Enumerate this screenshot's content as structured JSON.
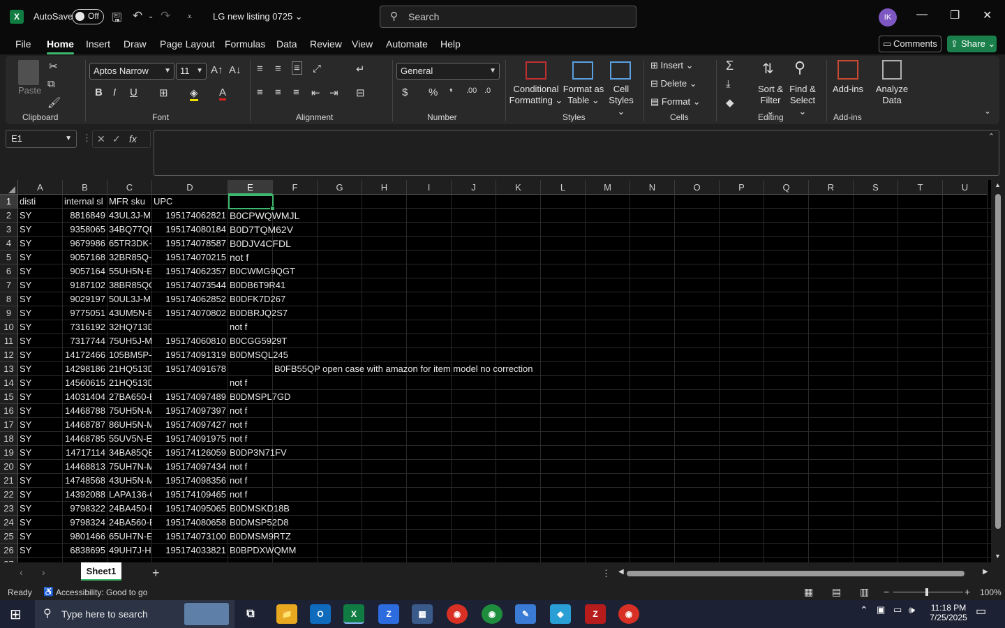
{
  "titlebar": {
    "autosave_label": "AutoSave",
    "autosave_state": "Off",
    "filename": "LG new listing 0725",
    "search_placeholder": "Search",
    "avatar_initials": "IK"
  },
  "menu": [
    "File",
    "Home",
    "Insert",
    "Draw",
    "Page Layout",
    "Formulas",
    "Data",
    "Review",
    "View",
    "Automate",
    "Help"
  ],
  "menu_active": "Home",
  "actions": {
    "comments": "Comments",
    "share": "Share"
  },
  "ribbon": {
    "clipboard": {
      "label": "Clipboard",
      "paste": "Paste"
    },
    "font": {
      "label": "Font",
      "family": "Aptos Narrow",
      "size": "11"
    },
    "alignment": {
      "label": "Alignment"
    },
    "number": {
      "label": "Number",
      "format": "General"
    },
    "styles": {
      "label": "Styles",
      "conditional_1": "Conditional",
      "conditional_2": "Formatting",
      "format_table_1": "Format as",
      "format_table_2": "Table",
      "cell_styles_1": "Cell",
      "cell_styles_2": "Styles"
    },
    "cells": {
      "label": "Cells",
      "insert": "Insert",
      "delete": "Delete",
      "format": "Format"
    },
    "editing": {
      "label": "Editing",
      "sort_1": "Sort &",
      "sort_2": "Filter",
      "find_1": "Find &",
      "find_2": "Select"
    },
    "addins": {
      "label": "Add-ins",
      "addins": "Add-ins",
      "analyze_1": "Analyze",
      "analyze_2": "Data"
    }
  },
  "formula_bar": {
    "name_box": "E1",
    "formula": ""
  },
  "columns": [
    "A",
    "B",
    "C",
    "D",
    "E",
    "F",
    "G",
    "H",
    "I",
    "J",
    "K",
    "L",
    "M",
    "N",
    "O",
    "P",
    "Q",
    "R",
    "S",
    "T",
    "U"
  ],
  "selected_column": "E",
  "selected_row": "1",
  "header_row": {
    "A": "disti",
    "B": "internal sl",
    "C": "MFR sku",
    "D": "UPC",
    "E": ""
  },
  "rows": [
    {
      "n": "2",
      "A": "SY",
      "B": "8816849",
      "C": "43UL3J-M",
      "D": "195174062821",
      "E": "B0CPWQWMJL",
      "big": true
    },
    {
      "n": "3",
      "A": "SY",
      "B": "9358065",
      "C": "34BQ77QE",
      "D": "195174080184",
      "E": "B0D7TQM62V",
      "big": true
    },
    {
      "n": "4",
      "A": "SY",
      "B": "9679986",
      "C": "65TR3DK-E",
      "D": "195174078587",
      "E": "B0DJV4CFDL",
      "big": true
    },
    {
      "n": "5",
      "A": "SY",
      "B": "9057168",
      "C": "32BR85Q-I",
      "D": "195174070215",
      "E": "not f",
      "big": true
    },
    {
      "n": "6",
      "A": "SY",
      "B": "9057164",
      "C": "55UH5N-E",
      "D": "195174062357",
      "E": "B0CWMG9QGT"
    },
    {
      "n": "7",
      "A": "SY",
      "B": "9187102",
      "C": "38BR85QC",
      "D": "195174073544",
      "E": "B0DB6T9R41"
    },
    {
      "n": "8",
      "A": "SY",
      "B": "9029197",
      "C": "50UL3J-M",
      "D": "195174062852",
      "E": "B0DFK7D267"
    },
    {
      "n": "9",
      "A": "SY",
      "B": "9775051",
      "C": "43UM5N-E",
      "D": "195174070802",
      "E": "B0DBRJQ2S7"
    },
    {
      "n": "10",
      "A": "SY",
      "B": "7316192",
      "C": "32HQ713D",
      "D": "",
      "E": "not f"
    },
    {
      "n": "11",
      "A": "SY",
      "B": "7317744",
      "C": "75UH5J-M",
      "D": "195174060810",
      "E": "B0CGG5929T"
    },
    {
      "n": "12",
      "A": "SY",
      "B": "14172466",
      "C": "105BM5P-",
      "D": "195174091319",
      "E": "B0DMSQL245"
    },
    {
      "n": "13",
      "A": "SY",
      "B": "14298186",
      "C": "21HQ513D",
      "D": "195174091678",
      "E": "",
      "F": "B0FB55QP open case with amazon for item model no correction"
    },
    {
      "n": "14",
      "A": "SY",
      "B": "14560615",
      "C": "21HQ513D",
      "D": "",
      "E": "not f"
    },
    {
      "n": "15",
      "A": "SY",
      "B": "14031404",
      "C": "27BA650-E",
      "D": "195174097489",
      "E": "B0DMSPL7GD"
    },
    {
      "n": "16",
      "A": "SY",
      "B": "14468788",
      "C": "75UH5N-M",
      "D": "195174097397",
      "E": "not f"
    },
    {
      "n": "17",
      "A": "SY",
      "B": "14468787",
      "C": "86UH5N-M",
      "D": "195174097427",
      "E": "not f"
    },
    {
      "n": "18",
      "A": "SY",
      "B": "14468785",
      "C": "55UV5N-E",
      "D": "195174091975",
      "E": "not f"
    },
    {
      "n": "19",
      "A": "SY",
      "B": "14717114",
      "C": "34BA85QE",
      "D": "195174126059",
      "E": "B0DP3N71FV"
    },
    {
      "n": "20",
      "A": "SY",
      "B": "14468813",
      "C": "75UH7N-M",
      "D": "195174097434",
      "E": "not f"
    },
    {
      "n": "21",
      "A": "SY",
      "B": "14748568",
      "C": "43UH5N-M",
      "D": "195174098356",
      "E": "not f"
    },
    {
      "n": "22",
      "A": "SY",
      "B": "14392088",
      "C": "LAPA136-C",
      "D": "195174109465",
      "E": "not f"
    },
    {
      "n": "23",
      "A": "SY",
      "B": "9798322",
      "C": "24BA450-E",
      "D": "195174095065",
      "E": "B0DMSKD18B"
    },
    {
      "n": "24",
      "A": "SY",
      "B": "9798324",
      "C": "24BA560-E",
      "D": "195174080658",
      "E": "B0DMSP52D8"
    },
    {
      "n": "25",
      "A": "SY",
      "B": "9801466",
      "C": "65UH7N-E",
      "D": "195174073100",
      "E": "B0DMSM9RTZ"
    },
    {
      "n": "26",
      "A": "SY",
      "B": "6838695",
      "C": "49UH7J-H",
      "D": "195174033821",
      "E": "B0BPDXWQMM"
    }
  ],
  "sheet_tab": "Sheet1",
  "status": {
    "ready": "Ready",
    "accessibility": "Accessibility: Good to go",
    "zoom": "100%"
  },
  "taskbar": {
    "search_placeholder": "Type here to search",
    "time": "11:18 PM",
    "date": "7/25/2025",
    "notif_count": "1"
  },
  "colors": {
    "accent": "#3eb86e",
    "excel_green": "#107c41",
    "share": "#1a7f4b",
    "avatar": "#7e57c2"
  }
}
